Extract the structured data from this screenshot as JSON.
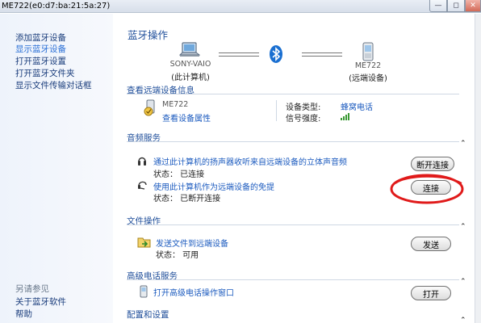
{
  "window": {
    "title": "ME722(e0:d7:ba:21:5a:27)",
    "controls": {
      "minimize": "—",
      "maximize": "◻",
      "close": "✕"
    }
  },
  "sidebar": {
    "items": [
      {
        "label": "添加蓝牙设备"
      },
      {
        "label": "显示蓝牙设备"
      },
      {
        "label": "打开蓝牙设置"
      },
      {
        "label": "打开蓝牙文件夹"
      },
      {
        "label": "显示文件传输对话框"
      }
    ],
    "see_also": {
      "heading": "另请参见",
      "items": [
        {
          "label": "关于蓝牙软件"
        },
        {
          "label": "帮助"
        }
      ]
    }
  },
  "main": {
    "heading": "蓝牙操作",
    "local_device": {
      "name": "SONY-VAIO",
      "label": "(此计算机)"
    },
    "remote_device": {
      "name": "ME722",
      "label": "(远端设备)"
    },
    "device_info": {
      "section_title": "查看远端设备信息",
      "device_name": "ME722",
      "properties_link": "查看设备属性",
      "type_label": "设备类型:",
      "type_value": "蜂窝电话",
      "signal_label": "信号强度:"
    },
    "audio": {
      "section_title": "音频服务",
      "stereo": {
        "title": "通过此计算机的扬声器收听来自远端设备的立体声音频",
        "status": "状态： 已连接",
        "button": "断开连接"
      },
      "handsfree": {
        "title": "使用此计算机作为远端设备的免提",
        "status": "状态： 已断开连接",
        "button": "连接"
      }
    },
    "file": {
      "section_title": "文件操作",
      "send": {
        "title": "发送文件到远端设备",
        "status": "状态： 可用",
        "button": "发送"
      }
    },
    "phone": {
      "section_title": "高级电话服务",
      "open": {
        "title": "打开高级电话操作窗口",
        "button": "打开"
      }
    },
    "config": {
      "section_title": "配置和设置"
    }
  },
  "icons": {
    "collapse": "chevron-up-icon",
    "bluetooth_color": "#1a6fd1",
    "annotation_circle_color": "#e01a1a"
  }
}
